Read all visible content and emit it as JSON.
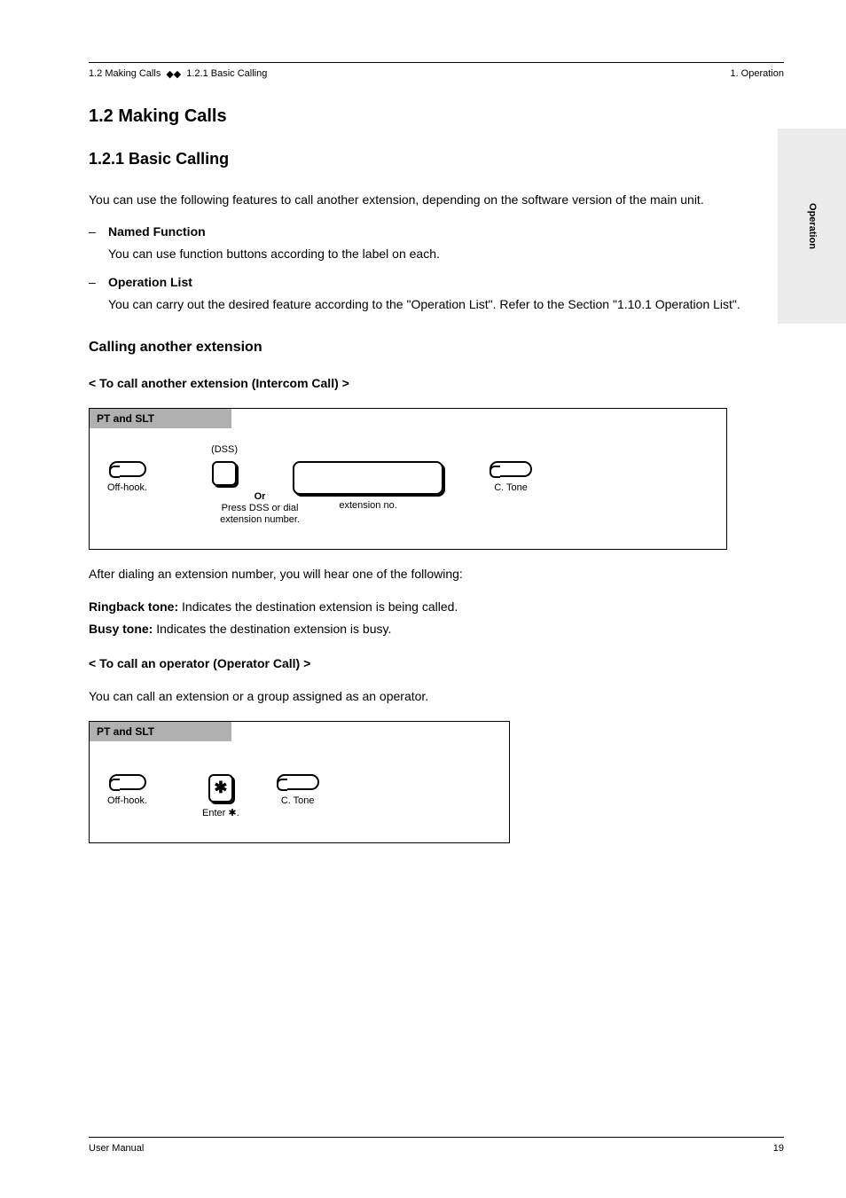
{
  "header": {
    "crumbs": [
      "1.2 Making Calls",
      "1.2.1 Basic Calling"
    ],
    "sep": "◆◆",
    "right": "1. Operation"
  },
  "side_tab": "Operation",
  "sections": [
    {
      "title": "1.2 Making Calls",
      "text": null
    },
    {
      "title": "1.2.1 Basic Calling",
      "text": "You can use the following features to call another extension, depending on the software version of the main unit."
    }
  ],
  "features": [
    {
      "name": "Named Function",
      "desc": "You can use function buttons according to the label on each."
    },
    {
      "name": "Operation List",
      "desc": "You can carry out the desired feature according to the \"Operation List\". Refer to the Section \"1.10.1 Operation List\"."
    }
  ],
  "sub1": {
    "title": "Calling another extension",
    "lead": "< To call another extension (Intercom Call) >",
    "proc_header": "PT and SLT",
    "steps": [
      {
        "label": "Off-hook.",
        "icon": "handset"
      },
      {
        "top": "(DSS)",
        "bottom": "Press DSS or dial extension number.",
        "icon": "flex"
      },
      {
        "label_or": "Or"
      },
      {
        "bottom": "extension no.",
        "icon": "longbox"
      },
      {
        "bottom": "C. Tone",
        "icon": "handset2",
        "top_space": true
      }
    ],
    "note": "After dialing an extension number, you will hear one of the following:",
    "rb": "Ringback tone:",
    "rb_desc": "Indicates the destination extension is being called.",
    "bt": "Busy tone:",
    "bt_desc": "Indicates the destination extension is busy."
  },
  "sub2": {
    "lead": "< To call an operator (Operator Call) >",
    "text": "You can call an extension or a group assigned as an operator.",
    "proc_header": "PT and SLT",
    "steps": [
      {
        "label": "Off-hook.",
        "icon": "handset"
      },
      {
        "bottom": "Enter  .",
        "icon": "star",
        "glyph": "✱"
      },
      {
        "bottom": "C. Tone",
        "icon": "handset2"
      }
    ]
  },
  "footer": {
    "left": "User Manual",
    "right": "19"
  }
}
